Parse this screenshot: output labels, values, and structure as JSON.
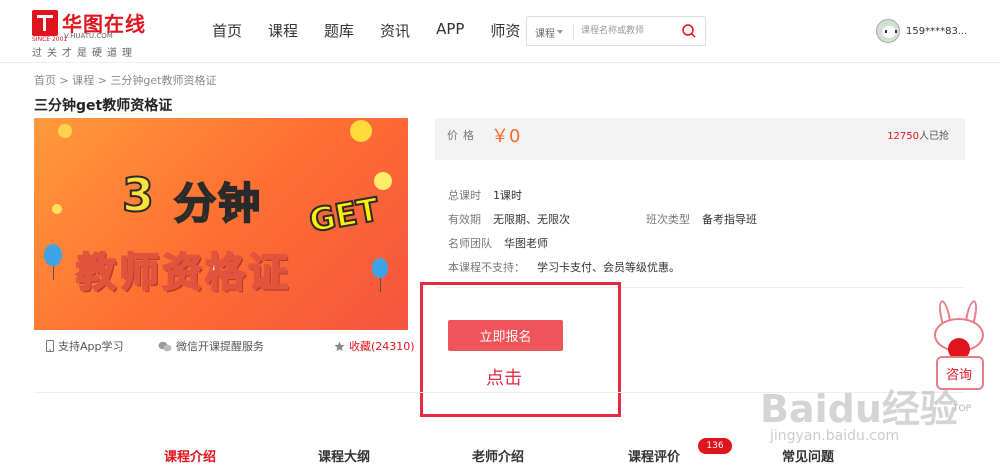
{
  "header": {
    "logo": {
      "title": "华图在线",
      "domain": "V.HUATU.COM",
      "since": "SINCE 2001",
      "slogan": "过关才是硬道理"
    },
    "nav": [
      "首页",
      "课程",
      "题库",
      "资讯",
      "APP",
      "师资"
    ],
    "search": {
      "category": "课程",
      "placeholder": "课程名称或教师"
    },
    "user": {
      "name": "159****83..."
    }
  },
  "breadcrumb": {
    "home": "首页",
    "sep1": ">",
    "course": "课程",
    "sep2": ">",
    "current": "三分钟get教师资格证"
  },
  "page_title": "三分钟get教师资格证",
  "banner": {
    "num": "3",
    "top": "分钟",
    "get": "GET",
    "bottom": "教师资格证"
  },
  "banner_footer": {
    "app": "支持App学习",
    "wechat": "微信开课提醒服务",
    "favorite_label": "收藏",
    "favorite_count": "(24310)"
  },
  "price": {
    "label": "价格",
    "value": "￥0",
    "sold_count": "12750",
    "sold_suffix": "人已抢"
  },
  "details": {
    "total_hours_label": "总课时",
    "total_hours": "1课时",
    "validity_label": "有效期",
    "validity": "无限期、无限次",
    "class_type_label": "班次类型",
    "class_type": "备考指导班",
    "teachers_label": "名师团队",
    "teachers": "华图老师",
    "unsupported_label": "本课程不支持：",
    "unsupported": "学习卡支付、会员等级优惠。"
  },
  "enroll_button": "立即报名",
  "annotation": "点击",
  "tabs": [
    "课程介绍",
    "课程大纲",
    "老师介绍",
    "课程评价",
    "常见问题"
  ],
  "review_badge": "136",
  "consult": "咨询",
  "watermark": {
    "main": "Baidu经验",
    "sub": "jingyan.baidu.com",
    "top": "TOP"
  },
  "colors": {
    "brand_red": "#e0141d",
    "enroll_button": "#f0545b",
    "price": "#f36b2c",
    "highlight": "#e42a44"
  }
}
